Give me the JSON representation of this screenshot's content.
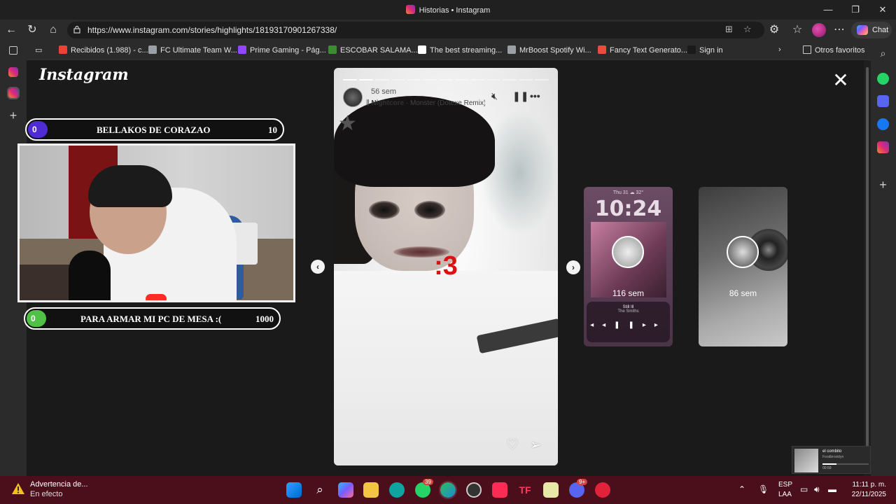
{
  "window": {
    "title": "Historias • Instagram"
  },
  "address": {
    "url": "https://www.instagram.com/stories/highlights/18193170901267338/"
  },
  "copilot": {
    "label": "Chat"
  },
  "favorites": [
    {
      "label": "Recibidos (1.988) - c...",
      "color": "#ea4335"
    },
    {
      "label": "FC Ultimate Team W...",
      "color": "#9aa0a6"
    },
    {
      "label": "Prime Gaming - Pág...",
      "color": "#9146ff"
    },
    {
      "label": "ESCOBAR SALAMA...",
      "color": "#3c8d2f"
    },
    {
      "label": "The best streaming...",
      "color": "#ffffff"
    },
    {
      "label": "MrBoost Spotify Wi...",
      "color": "#9aa0a6"
    },
    {
      "label": "Fancy Text Generato...",
      "color": "#e74c3c"
    },
    {
      "label": "Sign in",
      "color": "#1a1a1a"
    }
  ],
  "favorites_more": "Otros favoritos",
  "instagram_logo": "Instagram",
  "overlay": {
    "top_goal": {
      "current": "0",
      "title": "BELLAKOS DE CORAZAO",
      "target": "10",
      "color": "#4f2bd6"
    },
    "bottom_goal": {
      "current": "0",
      "title": "PARA ARMAR MI PC DE MESA :(",
      "target": "1000",
      "color": "#4fc246"
    }
  },
  "story": {
    "time": "56 sem",
    "artist": "Nightcore",
    "track": " · Monster (Dotexe Remix)",
    "caption": ":3",
    "segments_total": 13,
    "segments_done": 2
  },
  "side_stories": [
    {
      "age": "116 sem",
      "lock_date": "Thu 31  ☁  32°",
      "clock": "10:24",
      "song": "Still Ill",
      "artist": "The Smiths"
    },
    {
      "age": "86 sem"
    }
  ],
  "mini_player": {
    "title": "el combito",
    "subtitle": "Foodbrooklyn",
    "elapsed": "00:59",
    "total": "02:29"
  },
  "taskbar": {
    "warning_title": "Advertencia de...",
    "warning_sub": "En efecto",
    "whatsapp_badge": "39",
    "discord_badge": "9+",
    "lang1": "ESP",
    "lang2": "LAA",
    "time": "11:11 p. m.",
    "date": "22/11/2025"
  }
}
